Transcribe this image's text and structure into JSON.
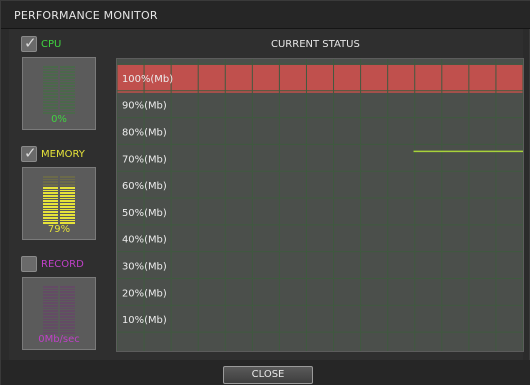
{
  "window": {
    "title": "PERFORMANCE MONITOR"
  },
  "panels": {
    "cpu": {
      "label": "CPU",
      "checked": true,
      "value": "0%",
      "level": 0.0,
      "color": "#3fd33f"
    },
    "memory": {
      "label": "MEMORY",
      "checked": true,
      "value": "79%",
      "level": 0.79,
      "color": "#e6e33a"
    },
    "record": {
      "label": "RECORD",
      "checked": false,
      "value": "0Mb/sec",
      "level": 0.0,
      "color": "#c040c8"
    }
  },
  "status": {
    "title": "CURRENT STATUS",
    "rows": [
      "100%(Mb)",
      "90%(Mb)",
      "80%(Mb)",
      "70%(Mb)",
      "60%(Mb)",
      "50%(Mb)",
      "40%(Mb)",
      "30%(Mb)",
      "20%(Mb)",
      "10%(Mb)"
    ],
    "highlight_color": "#c0504d"
  },
  "footer": {
    "close_label": "CLOSE"
  }
}
